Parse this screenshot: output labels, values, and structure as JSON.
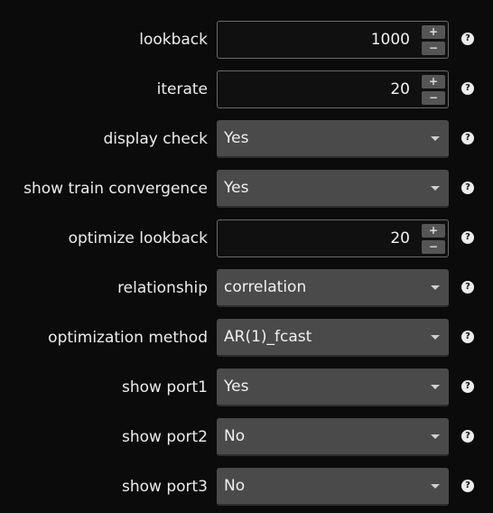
{
  "settings": [
    {
      "label": "lookback",
      "type": "number",
      "value": "1000"
    },
    {
      "label": "iterate",
      "type": "number",
      "value": "20"
    },
    {
      "label": "display check",
      "type": "select",
      "value": "Yes"
    },
    {
      "label": "show train convergence",
      "type": "select",
      "value": "Yes"
    },
    {
      "label": "optimize lookback",
      "type": "number",
      "value": "20"
    },
    {
      "label": "relationship",
      "type": "select",
      "value": "correlation"
    },
    {
      "label": "optimization method",
      "type": "select",
      "value": "AR(1)_fcast"
    },
    {
      "label": "show port1",
      "type": "select",
      "value": "Yes"
    },
    {
      "label": "show port2",
      "type": "select",
      "value": "No"
    },
    {
      "label": "show port3",
      "type": "select",
      "value": "No"
    }
  ],
  "controls": {
    "increment_symbol": "+",
    "decrement_symbol": "−",
    "help_symbol": "?"
  },
  "colors": {
    "background": "#0b0b0b",
    "select_background": "#4a4a4a",
    "number_border": "#6a6a6a",
    "text": "#ededed"
  }
}
